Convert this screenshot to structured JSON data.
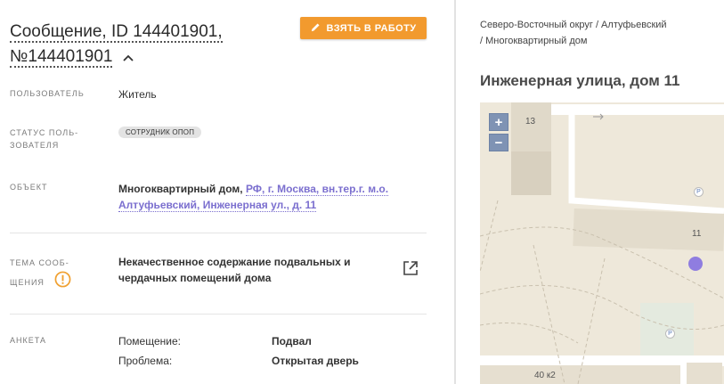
{
  "message": {
    "title_line1": "Сообщение, ID 144401901,",
    "title_line2": "№144401901",
    "take_button": "ВЗЯТЬ В РАБОТУ"
  },
  "fields": {
    "user_label": "ПОЛЬЗОВАТЕЛЬ",
    "user_value": "Житель",
    "status_label_1": "СТАТУС ПОЛЬ-",
    "status_label_2": "ЗОВАТЕЛЯ",
    "status_value": "СОТРУДНИК ОПОП",
    "object_label": "ОБЪЕКТ",
    "object_type": "Многоквартирный дом,",
    "object_link_1": "РФ, г. Москва, вн.тер.г. м.о.",
    "object_link_2": "Алтуфьевский, Инженерная ул., д. 11",
    "topic_label_1": "ТЕМА СООБ-",
    "topic_label_2": "ЩЕНИЯ",
    "topic_value_1": "Некачественное содержание подвальных и",
    "topic_value_2": "чердачных помещений дома",
    "survey_label": "АНКЕТА",
    "survey_rows": [
      {
        "q": "Помещение:",
        "a": "Подвал"
      },
      {
        "q": "Проблема:",
        "a": "Открытая дверь"
      }
    ]
  },
  "location": {
    "breadcrumb_1": "Северо-Восточный округ / Алтуфьевский",
    "breadcrumb_2": "/ Многоквартирный дом",
    "address": "Инженерная улица, дом 11",
    "map": {
      "zoom_in": "+",
      "zoom_out": "−",
      "building_13": "13",
      "building_11": "11",
      "building_40k2": "40 к2",
      "parking_1": "P",
      "parking_2": "P",
      "marker_color": "#8f7de0"
    }
  },
  "colors": {
    "accent": "#f29a2e",
    "link": "#7b6fcf",
    "warning": "#f0a030"
  }
}
